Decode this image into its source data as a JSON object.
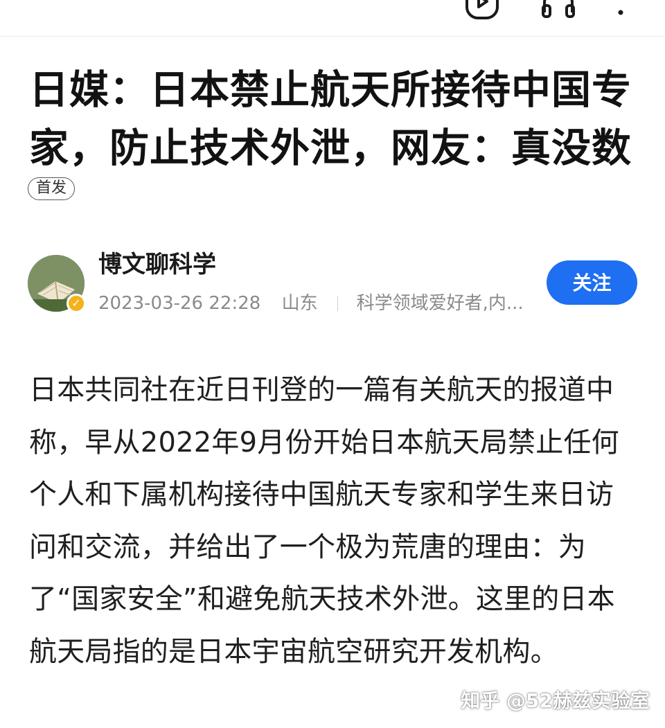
{
  "topbar": {
    "icons": [
      "video-icon",
      "audio-icon",
      "more-icon"
    ]
  },
  "article": {
    "title": "日媒：日本禁止航天所接待中国专家，防止技术外泄，网友：真没数",
    "badge": "首发",
    "author": {
      "name": "博文聊科学",
      "date": "2023-03-26 22:28",
      "location": "山东",
      "description": "科学领域爱好者,内..."
    },
    "follow_label": "关注",
    "paragraph": "日本共同社在近日刊登的一篇有关航天的报道中称，早从2022年9月份开始日本航天局禁止任何个人和下属机构接待中国航天专家和学生来日访问和交流，并给出了一个极为荒唐的理由：为了“国家安全”和避免航天技术外泄。这里的日本航天局指的是日本宇宙航空研究开发机构。"
  },
  "watermark": "知乎 @52赫兹实验室",
  "colors": {
    "accent": "#1e6ff1",
    "verified": "#f5b21b"
  }
}
